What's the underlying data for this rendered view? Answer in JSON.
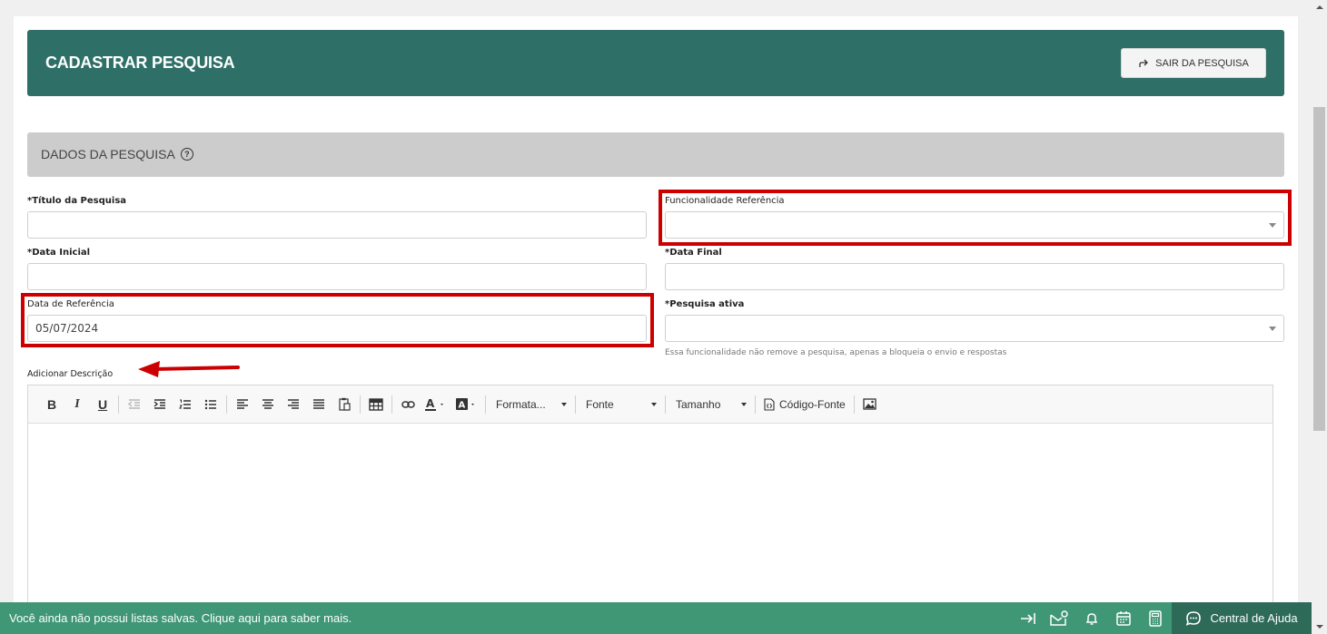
{
  "header": {
    "title": "CADASTRAR PESQUISA",
    "exit_label": "SAIR DA PESQUISA"
  },
  "section": {
    "title": "DADOS DA PESQUISA",
    "help_glyph": "?"
  },
  "form": {
    "titulo_label": "*Título da Pesquisa",
    "titulo_value": "",
    "funcionalidade_label": "Funcionalidade Referência",
    "funcionalidade_value": "",
    "data_inicial_label": "*Data Inicial",
    "data_inicial_value": "",
    "data_final_label": "*Data Final",
    "data_final_value": "",
    "data_referencia_label": "Data de Referência",
    "data_referencia_value": "05/07/2024",
    "pesquisa_ativa_label": "*Pesquisa ativa",
    "pesquisa_ativa_value": "",
    "pesquisa_ativa_hint": "Essa funcionalidade não remove a pesquisa, apenas a bloqueia o envio e respostas",
    "descricao_label": "Adicionar Descrição"
  },
  "editor": {
    "format_label": "Formata...",
    "font_label": "Fonte",
    "size_label": "Tamanho",
    "source_label": "Código-Fonte",
    "bold_glyph": "B",
    "italic_glyph": "I",
    "underline_glyph": "U",
    "body_text": ""
  },
  "bottom_bar": {
    "message": "Você ainda não possui listas salvas. Clique aqui para saber mais.",
    "help_label": "Central de Ajuda"
  },
  "colors": {
    "header_bg": "#2e6f67",
    "bottom_bar_bg": "#3f9775",
    "help_center_bg": "#2d6a58",
    "highlight": "#cc0000"
  }
}
